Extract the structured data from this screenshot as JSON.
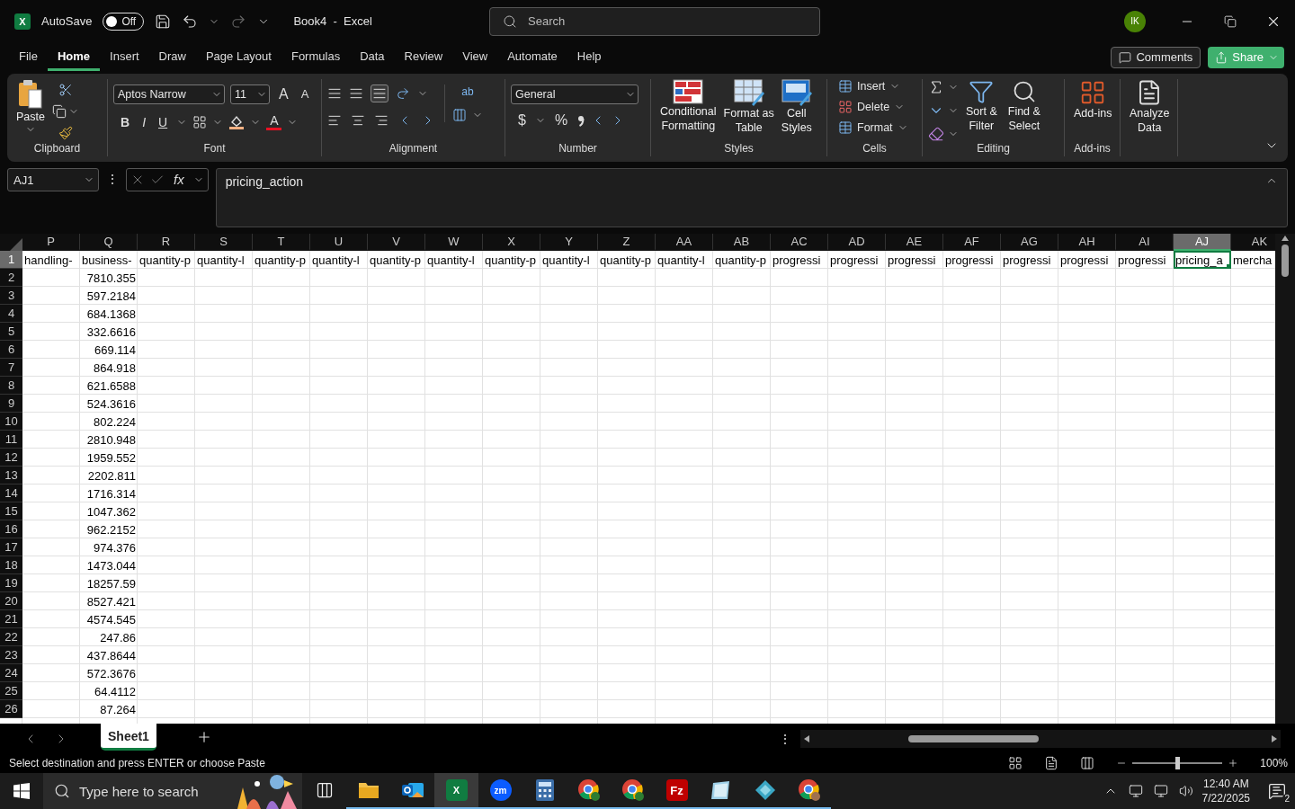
{
  "title_bar": {
    "app_logo": "X",
    "autosave_label": "AutoSave",
    "autosave": {
      "on": false,
      "label": "Off"
    },
    "title": "Book4  -  Excel",
    "search_placeholder": "Search",
    "avatar": "IK"
  },
  "menu_tabs": [
    {
      "label": "File",
      "selected": false
    },
    {
      "label": "Home",
      "selected": true
    },
    {
      "label": "Insert",
      "selected": false
    },
    {
      "label": "Draw",
      "selected": false
    },
    {
      "label": "Page Layout",
      "selected": false
    },
    {
      "label": "Formulas",
      "selected": false
    },
    {
      "label": "Data",
      "selected": false
    },
    {
      "label": "Review",
      "selected": false
    },
    {
      "label": "View",
      "selected": false
    },
    {
      "label": "Automate",
      "selected": false
    },
    {
      "label": "Help",
      "selected": false
    }
  ],
  "comments_button": "Comments",
  "share_button": "Share",
  "ribbon": {
    "clipboard": {
      "label": "Clipboard",
      "paste": "Paste"
    },
    "font": {
      "label": "Font",
      "font_name": "Aptos Narrow",
      "font_size": "11",
      "grow": "A",
      "shrink": "A",
      "bold": "B",
      "italic": "I",
      "underline": "U",
      "font_color": "A"
    },
    "alignment": {
      "label": "Alignment",
      "wrap": "ab"
    },
    "number": {
      "label": "Number",
      "format": "General",
      "currency": "$",
      "percent": "%"
    },
    "styles": {
      "label": "Styles",
      "buttons": [
        {
          "lines": [
            "Conditional",
            "Formatting"
          ],
          "kind": "conditional"
        },
        {
          "lines": [
            "Format as",
            "Table"
          ],
          "kind": "table"
        },
        {
          "lines": [
            "Cell",
            "Styles"
          ],
          "kind": "cellstyles"
        }
      ]
    },
    "cells": {
      "label": "Cells",
      "buttons": [
        {
          "label": "Insert",
          "kind": "insert"
        },
        {
          "label": "Delete",
          "kind": "delete"
        },
        {
          "label": "Format",
          "kind": "format"
        }
      ]
    },
    "editing": {
      "label": "Editing",
      "buttons": [
        {
          "lines": [
            "Sort &",
            "Filter"
          ],
          "kind": "sort"
        },
        {
          "lines": [
            "Find &",
            "Select"
          ],
          "kind": "find"
        }
      ]
    },
    "addins": {
      "label": "Add-ins",
      "button": "Add-ins"
    },
    "analyze": {
      "lines": [
        "Analyze",
        "Data"
      ]
    }
  },
  "formula_bar": {
    "name_box": "AJ1",
    "more": "⋮",
    "fx": "fx",
    "formula": "pricing_action"
  },
  "sheet": {
    "columns": [
      {
        "letter": "P",
        "selected": false
      },
      {
        "letter": "Q",
        "selected": false
      },
      {
        "letter": "R",
        "selected": false
      },
      {
        "letter": "S",
        "selected": false
      },
      {
        "letter": "T",
        "selected": false
      },
      {
        "letter": "U",
        "selected": false
      },
      {
        "letter": "V",
        "selected": false
      },
      {
        "letter": "W",
        "selected": false
      },
      {
        "letter": "X",
        "selected": false
      },
      {
        "letter": "Y",
        "selected": false
      },
      {
        "letter": "Z",
        "selected": false
      },
      {
        "letter": "AA",
        "selected": false
      },
      {
        "letter": "AB",
        "selected": false
      },
      {
        "letter": "AC",
        "selected": false
      },
      {
        "letter": "AD",
        "selected": false
      },
      {
        "letter": "AE",
        "selected": false
      },
      {
        "letter": "AF",
        "selected": false
      },
      {
        "letter": "AG",
        "selected": false
      },
      {
        "letter": "AH",
        "selected": false
      },
      {
        "letter": "AI",
        "selected": false
      },
      {
        "letter": "AJ",
        "selected": true
      },
      {
        "letter": "AK",
        "selected": false
      }
    ],
    "rows": [
      {
        "number": "1",
        "selected": true,
        "cells": [
          {
            "text": "handling-",
            "selected": false
          },
          {
            "text": "business-",
            "selected": false
          },
          {
            "text": "quantity-p",
            "selected": false
          },
          {
            "text": "quantity-l",
            "selected": false
          },
          {
            "text": "quantity-p",
            "selected": false
          },
          {
            "text": "quantity-l",
            "selected": false
          },
          {
            "text": "quantity-p",
            "selected": false
          },
          {
            "text": "quantity-l",
            "selected": false
          },
          {
            "text": "quantity-p",
            "selected": false
          },
          {
            "text": "quantity-l",
            "selected": false
          },
          {
            "text": "quantity-p",
            "selected": false
          },
          {
            "text": "quantity-l",
            "selected": false
          },
          {
            "text": "quantity-p",
            "selected": false
          },
          {
            "text": "progressi",
            "selected": false
          },
          {
            "text": "progressi",
            "selected": false
          },
          {
            "text": "progressi",
            "selected": false
          },
          {
            "text": "progressi",
            "selected": false
          },
          {
            "text": "progressi",
            "selected": false
          },
          {
            "text": "progressi",
            "selected": false
          },
          {
            "text": "progressi",
            "selected": false
          },
          {
            "text": "pricing_a",
            "selected": true
          },
          {
            "text": "mercha",
            "selected": false
          }
        ]
      },
      {
        "number": "2",
        "selected": false,
        "column_Q": "7810.355"
      },
      {
        "number": "3",
        "selected": false,
        "column_Q": "597.2184"
      },
      {
        "number": "4",
        "selected": false,
        "column_Q": "684.1368"
      },
      {
        "number": "5",
        "selected": false,
        "column_Q": "332.6616"
      },
      {
        "number": "6",
        "selected": false,
        "column_Q": "669.114"
      },
      {
        "number": "7",
        "selected": false,
        "column_Q": "864.918"
      },
      {
        "number": "8",
        "selected": false,
        "column_Q": "621.6588"
      },
      {
        "number": "9",
        "selected": false,
        "column_Q": "524.3616"
      },
      {
        "number": "10",
        "selected": false,
        "column_Q": "802.224"
      },
      {
        "number": "11",
        "selected": false,
        "column_Q": "2810.948"
      },
      {
        "number": "12",
        "selected": false,
        "column_Q": "1959.552"
      },
      {
        "number": "13",
        "selected": false,
        "column_Q": "2202.811"
      },
      {
        "number": "14",
        "selected": false,
        "column_Q": "1716.314"
      },
      {
        "number": "15",
        "selected": false,
        "column_Q": "1047.362"
      },
      {
        "number": "16",
        "selected": false,
        "column_Q": "962.2152"
      },
      {
        "number": "17",
        "selected": false,
        "column_Q": "974.376"
      },
      {
        "number": "18",
        "selected": false,
        "column_Q": "1473.044"
      },
      {
        "number": "19",
        "selected": false,
        "column_Q": "18257.59"
      },
      {
        "number": "20",
        "selected": false,
        "column_Q": "8527.421"
      },
      {
        "number": "21",
        "selected": false,
        "column_Q": "4574.545"
      },
      {
        "number": "22",
        "selected": false,
        "column_Q": "247.86"
      },
      {
        "number": "23",
        "selected": false,
        "column_Q": "437.8644"
      },
      {
        "number": "24",
        "selected": false,
        "column_Q": "572.3676"
      },
      {
        "number": "25",
        "selected": false,
        "column_Q": "64.4112"
      },
      {
        "number": "26",
        "selected": false,
        "column_Q": "87.264"
      }
    ]
  },
  "sheet_tabs": [
    {
      "label": "Sheet1",
      "selected": true
    }
  ],
  "sheet_tab_bar": {
    "more": "⋮"
  },
  "status_bar": {
    "message": "Select destination and press ENTER or choose Paste",
    "zoom": {
      "level": 0.5,
      "label": "100%"
    }
  },
  "taskbar": {
    "search_placeholder": "Type here to search",
    "apps": [
      {
        "kind": "taskview",
        "selected": false,
        "running": false
      },
      {
        "kind": "explorer",
        "selected": false,
        "running": true
      },
      {
        "kind": "outlook",
        "selected": false,
        "running": true
      },
      {
        "kind": "excel",
        "selected": true,
        "running": true,
        "label": "X"
      },
      {
        "kind": "zoom",
        "selected": false,
        "running": true,
        "label": "zm"
      },
      {
        "kind": "calculator",
        "selected": false,
        "running": true
      },
      {
        "kind": "chrome",
        "selected": false,
        "running": true
      },
      {
        "kind": "chrome",
        "selected": false,
        "running": true
      },
      {
        "kind": "filezilla",
        "selected": false,
        "running": true,
        "label": "Fz"
      },
      {
        "kind": "notes",
        "selected": false,
        "running": true
      },
      {
        "kind": "diamond",
        "selected": false,
        "running": true
      },
      {
        "kind": "chromeprofile",
        "selected": false,
        "running": true
      }
    ],
    "time": "12:40 AM",
    "date": "7/22/2025",
    "notifications": "2"
  }
}
